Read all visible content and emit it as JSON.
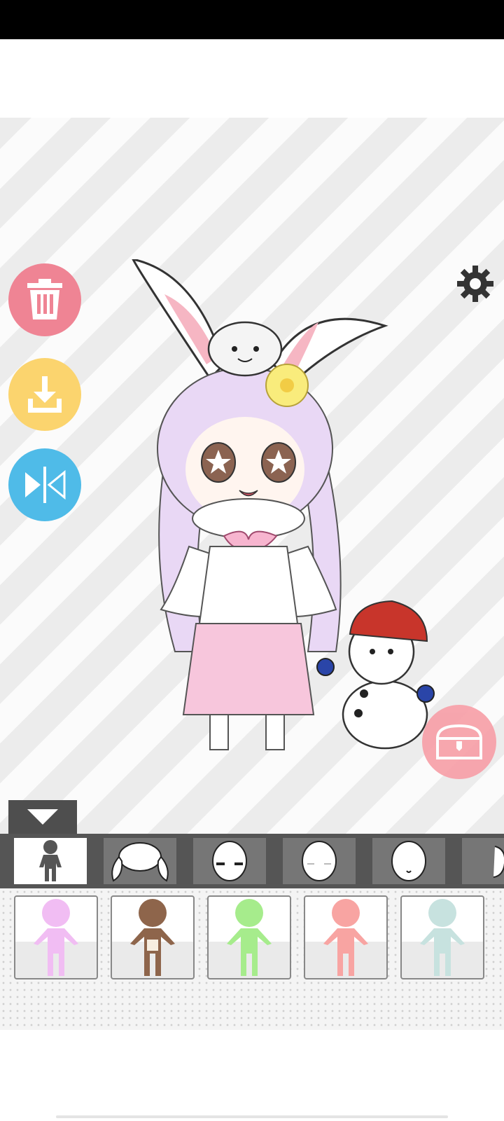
{
  "icons": {
    "trash": "trash-icon",
    "download": "download-icon",
    "flip": "flip-icon",
    "settings": "gear-icon",
    "chest": "treasure-chest-icon",
    "collapse": "triangle-down-icon"
  },
  "colors": {
    "trash_button": "#ef8494",
    "download_button": "#fbd46e",
    "flip_button": "#4fbbe8",
    "chest_button": "#f7a0a8",
    "category_bar": "#555555",
    "hair": "#e9d8f5",
    "skirt": "#f7c6dc"
  },
  "categories": [
    {
      "name": "body",
      "selected": true
    },
    {
      "name": "hair",
      "selected": false
    },
    {
      "name": "eyes",
      "selected": false
    },
    {
      "name": "face",
      "selected": false
    },
    {
      "name": "mouth",
      "selected": false
    },
    {
      "name": "ears",
      "selected": false
    }
  ],
  "body_options": [
    {
      "name": "lilac-skin",
      "color": "#f1bdf3"
    },
    {
      "name": "brown-skin",
      "color": "#8e654b"
    },
    {
      "name": "green-skin",
      "color": "#a6ec8c"
    },
    {
      "name": "coral-skin",
      "color": "#f8a4a2"
    },
    {
      "name": "mint-skin",
      "color": "#c7e2df"
    }
  ]
}
